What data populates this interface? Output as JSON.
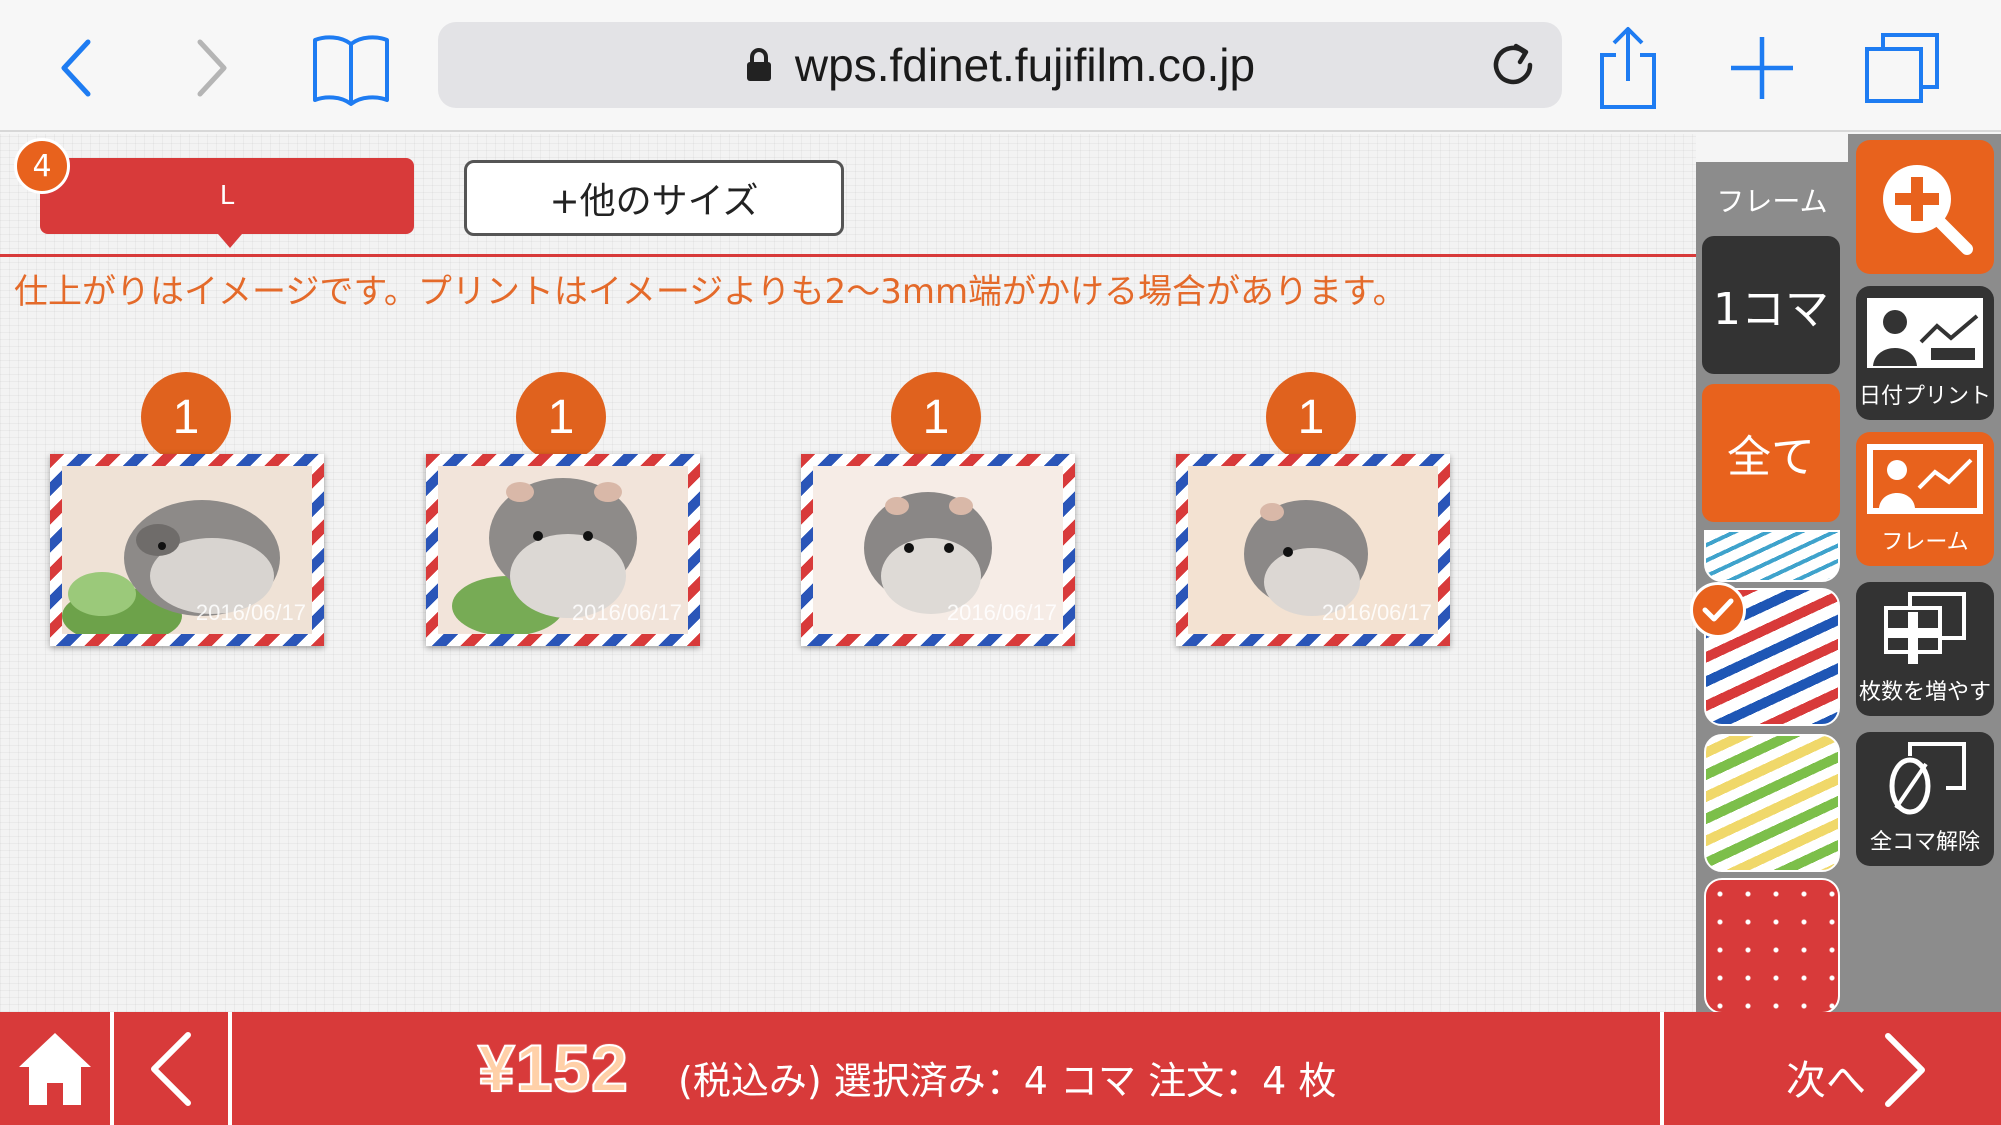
{
  "browser": {
    "url": "wps.fdinet.fujifilm.co.jp"
  },
  "order": {
    "size_tab_label": "L",
    "size_count": "4",
    "other_size_label": "+他のサイズ",
    "notice": "仕上がりはイメージです。プリントはイメージよりも2～3mm端がかける場合があります。"
  },
  "photos": [
    {
      "qty": "1",
      "date": "2016/06/17"
    },
    {
      "qty": "1",
      "date": "2016/06/17"
    },
    {
      "qty": "1",
      "date": "2016/06/17"
    },
    {
      "qty": "1",
      "date": "2016/06/17"
    }
  ],
  "frame_panel": {
    "title": "フレーム",
    "one_frame": "1コマ",
    "all": "全て"
  },
  "tools": {
    "zoom": "",
    "date_print": "日付プリント",
    "frame": "フレーム",
    "add_copies": "枚数を増やす",
    "clear_all": "全コマ解除"
  },
  "footer": {
    "price": "¥152",
    "summary": "(税込み) 選択済み：4 コマ 注文：4 枚",
    "next": "次へ"
  },
  "colors": {
    "accent_red": "#d83a3a",
    "accent_orange": "#e8621d",
    "notice_orange": "#e46a2a",
    "panel_gray": "#8c8c8c",
    "ios_blue": "#1e7cf2"
  }
}
